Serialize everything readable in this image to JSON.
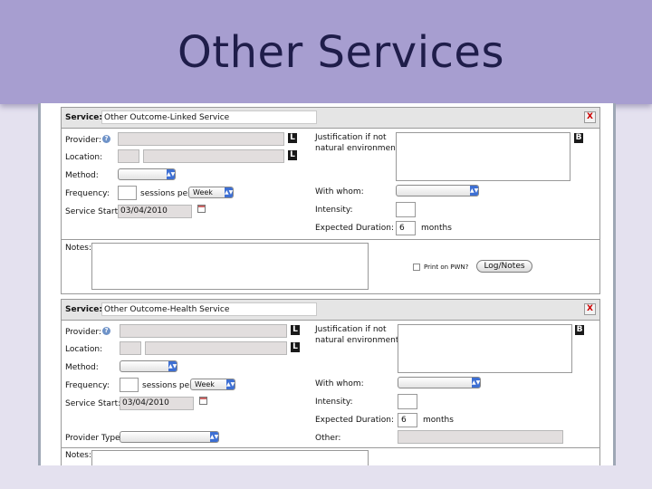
{
  "slide": {
    "title": "Other Services"
  },
  "labels": {
    "service": "Service:",
    "provider": "Provider:",
    "location": "Location:",
    "method": "Method:",
    "frequency": "Frequency:",
    "sessions_per": "sessions per",
    "service_start": "Service Start:",
    "justification_line1": "Justification if not",
    "justification_line2": "natural environment:",
    "with_whom": "With whom:",
    "intensity": "Intensity:",
    "expected_duration": "Expected Duration:",
    "months": "months",
    "notes": "Notes:",
    "print_on_pwn": "Print on PWN?",
    "log_notes": "Log/Notes",
    "provider_type": "Provider Type:",
    "other": "Other:",
    "l_button": "L",
    "b_button": "B",
    "close": "X",
    "help": "?"
  },
  "services": [
    {
      "name": "Other Outcome-Linked Service",
      "frequency_unit": "Week",
      "service_start": "03/04/2010",
      "expected_duration": "6"
    },
    {
      "name": "Other Outcome-Health Service",
      "frequency_unit": "Week",
      "service_start": "03/04/2010",
      "expected_duration": "6"
    }
  ]
}
